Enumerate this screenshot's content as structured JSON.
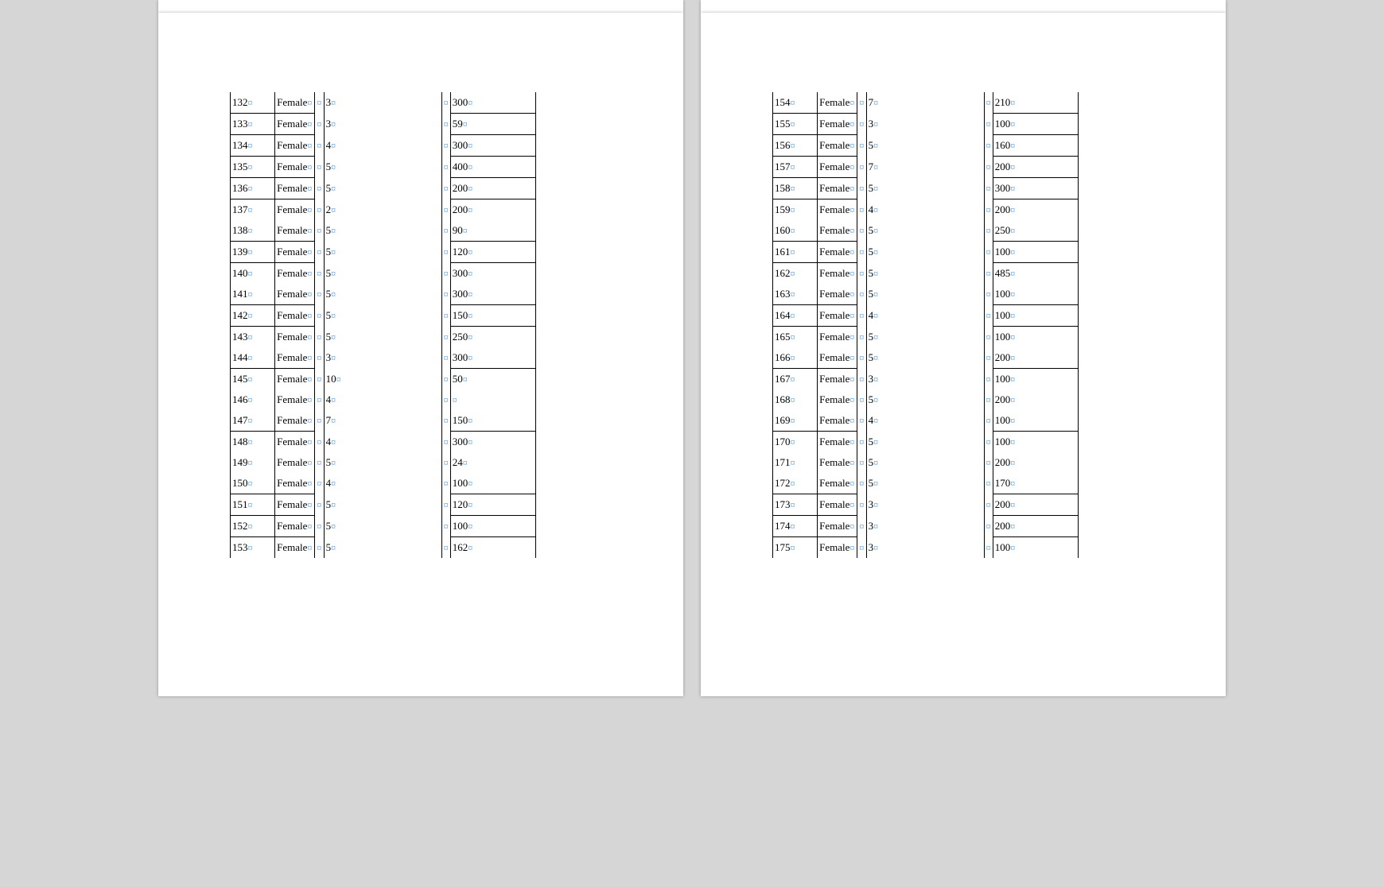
{
  "mark": "¤",
  "pages": [
    {
      "rows": [
        {
          "id": "132",
          "gender": "Female",
          "v1": "3",
          "v2": "300",
          "topBorder": [
            false,
            false,
            false,
            false,
            false,
            false
          ],
          "bottomBorder": [
            true,
            true,
            false,
            false,
            false,
            true
          ]
        },
        {
          "id": "133",
          "gender": "Female",
          "v1": "3",
          "v2": "59",
          "topBorder": [
            false,
            false,
            false,
            false,
            false,
            false
          ],
          "bottomBorder": [
            true,
            true,
            false,
            false,
            false,
            true
          ]
        },
        {
          "id": "134",
          "gender": "Female",
          "v1": "4",
          "v2": "300",
          "topBorder": [
            false,
            false,
            false,
            false,
            false,
            false
          ],
          "bottomBorder": [
            true,
            true,
            false,
            false,
            false,
            true
          ]
        },
        {
          "id": "135",
          "gender": "Female",
          "v1": "5",
          "v2": "400",
          "topBorder": [
            false,
            false,
            false,
            false,
            false,
            false
          ],
          "bottomBorder": [
            true,
            true,
            false,
            false,
            false,
            true
          ]
        },
        {
          "id": "136",
          "gender": "Female",
          "v1": "5",
          "v2": "200",
          "topBorder": [
            false,
            false,
            false,
            false,
            false,
            false
          ],
          "bottomBorder": [
            true,
            true,
            false,
            false,
            false,
            true
          ]
        },
        {
          "id": "137",
          "gender": "Female",
          "v1": "2",
          "v2": "200",
          "topBorder": [
            false,
            false,
            false,
            false,
            false,
            false
          ],
          "bottomBorder": [
            false,
            false,
            false,
            false,
            false,
            false
          ]
        },
        {
          "id": "138",
          "gender": "Female",
          "v1": "5",
          "v2": "90",
          "topBorder": [
            false,
            false,
            false,
            false,
            false,
            false
          ],
          "bottomBorder": [
            true,
            true,
            false,
            false,
            false,
            true
          ]
        },
        {
          "id": "139",
          "gender": "Female",
          "v1": "5",
          "v2": "120",
          "topBorder": [
            false,
            false,
            false,
            false,
            false,
            false
          ],
          "bottomBorder": [
            true,
            true,
            false,
            false,
            false,
            true
          ]
        },
        {
          "id": "140",
          "gender": "Female",
          "v1": "5",
          "v2": "300",
          "topBorder": [
            false,
            false,
            false,
            false,
            false,
            false
          ],
          "bottomBorder": [
            false,
            false,
            false,
            false,
            false,
            false
          ]
        },
        {
          "id": "141",
          "gender": "Female",
          "v1": "5",
          "v2": "300",
          "topBorder": [
            false,
            false,
            false,
            false,
            false,
            false
          ],
          "bottomBorder": [
            true,
            true,
            false,
            false,
            false,
            true
          ]
        },
        {
          "id": "142",
          "gender": "Female",
          "v1": "5",
          "v2": "150",
          "topBorder": [
            false,
            false,
            false,
            false,
            false,
            false
          ],
          "bottomBorder": [
            true,
            true,
            false,
            false,
            false,
            true
          ]
        },
        {
          "id": "143",
          "gender": "Female",
          "v1": "5",
          "v2": "250",
          "topBorder": [
            false,
            false,
            false,
            false,
            false,
            false
          ],
          "bottomBorder": [
            false,
            false,
            false,
            false,
            false,
            false
          ]
        },
        {
          "id": "144",
          "gender": "Female",
          "v1": "3",
          "v2": "300",
          "topBorder": [
            false,
            false,
            false,
            false,
            false,
            false
          ],
          "bottomBorder": [
            true,
            true,
            false,
            false,
            false,
            true
          ]
        },
        {
          "id": "145",
          "gender": "Female",
          "v1": "10",
          "v2": "50",
          "topBorder": [
            false,
            false,
            false,
            false,
            false,
            false
          ],
          "bottomBorder": [
            false,
            false,
            false,
            false,
            false,
            false
          ]
        },
        {
          "id": "146",
          "gender": "Female",
          "v1": "4",
          "v2": "",
          "topBorder": [
            false,
            false,
            false,
            false,
            false,
            false
          ],
          "bottomBorder": [
            false,
            false,
            false,
            false,
            false,
            false
          ]
        },
        {
          "id": "147",
          "gender": "Female",
          "v1": "7",
          "v2": "150",
          "topBorder": [
            false,
            false,
            false,
            false,
            false,
            false
          ],
          "bottomBorder": [
            true,
            true,
            false,
            false,
            false,
            true
          ]
        },
        {
          "id": "148",
          "gender": "Female",
          "v1": "4",
          "v2": "300",
          "topBorder": [
            false,
            false,
            false,
            false,
            false,
            false
          ],
          "bottomBorder": [
            false,
            false,
            false,
            false,
            false,
            false
          ]
        },
        {
          "id": "149",
          "gender": "Female",
          "v1": "5",
          "v2": "24",
          "topBorder": [
            false,
            false,
            false,
            false,
            false,
            false
          ],
          "bottomBorder": [
            false,
            false,
            false,
            false,
            false,
            false
          ]
        },
        {
          "id": "150",
          "gender": "Female",
          "v1": "4",
          "v2": "100",
          "topBorder": [
            false,
            false,
            false,
            false,
            false,
            false
          ],
          "bottomBorder": [
            true,
            true,
            false,
            false,
            false,
            true
          ]
        },
        {
          "id": "151",
          "gender": "Female",
          "v1": "5",
          "v2": "120",
          "topBorder": [
            false,
            false,
            false,
            false,
            false,
            false
          ],
          "bottomBorder": [
            true,
            true,
            false,
            false,
            false,
            true
          ]
        },
        {
          "id": "152",
          "gender": "Female",
          "v1": "5",
          "v2": "100",
          "topBorder": [
            false,
            false,
            false,
            false,
            false,
            false
          ],
          "bottomBorder": [
            true,
            true,
            false,
            false,
            false,
            true
          ]
        },
        {
          "id": "153",
          "gender": "Female",
          "v1": "5",
          "v2": "162",
          "topBorder": [
            false,
            false,
            false,
            false,
            false,
            false
          ],
          "bottomBorder": [
            false,
            false,
            false,
            false,
            false,
            false
          ]
        }
      ]
    },
    {
      "rows": [
        {
          "id": "154",
          "gender": "Female",
          "v1": "7",
          "v2": "210",
          "topBorder": [
            false,
            false,
            false,
            false,
            false,
            false
          ],
          "bottomBorder": [
            true,
            true,
            false,
            false,
            false,
            true
          ]
        },
        {
          "id": "155",
          "gender": "Female",
          "v1": "3",
          "v2": "100",
          "topBorder": [
            false,
            false,
            false,
            false,
            false,
            false
          ],
          "bottomBorder": [
            true,
            true,
            false,
            false,
            false,
            true
          ]
        },
        {
          "id": "156",
          "gender": "Female",
          "v1": "5",
          "v2": "160",
          "topBorder": [
            false,
            false,
            false,
            false,
            false,
            false
          ],
          "bottomBorder": [
            true,
            true,
            false,
            false,
            false,
            true
          ]
        },
        {
          "id": "157",
          "gender": "Female",
          "v1": "7",
          "v2": "200",
          "topBorder": [
            false,
            false,
            false,
            false,
            false,
            false
          ],
          "bottomBorder": [
            true,
            true,
            false,
            false,
            false,
            true
          ]
        },
        {
          "id": "158",
          "gender": "Female",
          "v1": "5",
          "v2": "300",
          "topBorder": [
            false,
            false,
            false,
            false,
            false,
            false
          ],
          "bottomBorder": [
            true,
            true,
            false,
            false,
            false,
            true
          ]
        },
        {
          "id": "159",
          "gender": "Female",
          "v1": "4",
          "v2": "200",
          "topBorder": [
            false,
            false,
            false,
            false,
            false,
            false
          ],
          "bottomBorder": [
            false,
            false,
            false,
            false,
            false,
            false
          ]
        },
        {
          "id": "160",
          "gender": "Female",
          "v1": "5",
          "v2": "250",
          "topBorder": [
            false,
            false,
            false,
            false,
            false,
            false
          ],
          "bottomBorder": [
            true,
            true,
            false,
            false,
            false,
            true
          ]
        },
        {
          "id": "161",
          "gender": "Female",
          "v1": "5",
          "v2": "100",
          "topBorder": [
            false,
            false,
            false,
            false,
            false,
            false
          ],
          "bottomBorder": [
            true,
            true,
            false,
            false,
            false,
            true
          ]
        },
        {
          "id": "162",
          "gender": "Female",
          "v1": "5",
          "v2": "485",
          "topBorder": [
            false,
            false,
            false,
            false,
            false,
            false
          ],
          "bottomBorder": [
            false,
            false,
            false,
            false,
            false,
            false
          ]
        },
        {
          "id": "163",
          "gender": "Female",
          "v1": "5",
          "v2": "100",
          "topBorder": [
            false,
            false,
            false,
            false,
            false,
            false
          ],
          "bottomBorder": [
            true,
            true,
            false,
            false,
            false,
            true
          ]
        },
        {
          "id": "164",
          "gender": "Female",
          "v1": "4",
          "v2": "100",
          "topBorder": [
            false,
            false,
            false,
            false,
            false,
            false
          ],
          "bottomBorder": [
            true,
            true,
            false,
            false,
            false,
            true
          ]
        },
        {
          "id": "165",
          "gender": "Female",
          "v1": "5",
          "v2": "100",
          "topBorder": [
            false,
            false,
            false,
            false,
            false,
            false
          ],
          "bottomBorder": [
            false,
            false,
            false,
            false,
            false,
            false
          ]
        },
        {
          "id": "166",
          "gender": "Female",
          "v1": "5",
          "v2": "200",
          "topBorder": [
            false,
            false,
            false,
            false,
            false,
            false
          ],
          "bottomBorder": [
            true,
            true,
            false,
            false,
            false,
            true
          ]
        },
        {
          "id": "167",
          "gender": "Female",
          "v1": "3",
          "v2": "100",
          "topBorder": [
            false,
            false,
            false,
            false,
            false,
            false
          ],
          "bottomBorder": [
            false,
            false,
            false,
            false,
            false,
            false
          ]
        },
        {
          "id": "168",
          "gender": "Female",
          "v1": "5",
          "v2": "200",
          "topBorder": [
            false,
            false,
            false,
            false,
            false,
            false
          ],
          "bottomBorder": [
            false,
            false,
            false,
            false,
            false,
            false
          ]
        },
        {
          "id": "169",
          "gender": "Female",
          "v1": "4",
          "v2": "100",
          "topBorder": [
            false,
            false,
            false,
            false,
            false,
            false
          ],
          "bottomBorder": [
            true,
            true,
            false,
            false,
            false,
            true
          ]
        },
        {
          "id": "170",
          "gender": "Female",
          "v1": "5",
          "v2": "100",
          "topBorder": [
            false,
            false,
            false,
            false,
            false,
            false
          ],
          "bottomBorder": [
            false,
            false,
            false,
            false,
            false,
            false
          ]
        },
        {
          "id": "171",
          "gender": "Female",
          "v1": "5",
          "v2": "200",
          "topBorder": [
            false,
            false,
            false,
            false,
            false,
            false
          ],
          "bottomBorder": [
            false,
            false,
            false,
            false,
            false,
            false
          ]
        },
        {
          "id": "172",
          "gender": "Female",
          "v1": "5",
          "v2": "170",
          "topBorder": [
            false,
            false,
            false,
            false,
            false,
            false
          ],
          "bottomBorder": [
            true,
            true,
            false,
            false,
            false,
            true
          ]
        },
        {
          "id": "173",
          "gender": "Female",
          "v1": "3",
          "v2": "200",
          "topBorder": [
            false,
            false,
            false,
            false,
            false,
            false
          ],
          "bottomBorder": [
            true,
            true,
            false,
            false,
            false,
            true
          ]
        },
        {
          "id": "174",
          "gender": "Female",
          "v1": "3",
          "v2": "200",
          "topBorder": [
            false,
            false,
            false,
            false,
            false,
            false
          ],
          "bottomBorder": [
            true,
            true,
            false,
            false,
            false,
            true
          ]
        },
        {
          "id": "175",
          "gender": "Female",
          "v1": "3",
          "v2": "100",
          "topBorder": [
            false,
            false,
            false,
            false,
            false,
            false
          ],
          "bottomBorder": [
            false,
            false,
            false,
            false,
            false,
            false
          ]
        }
      ]
    }
  ]
}
